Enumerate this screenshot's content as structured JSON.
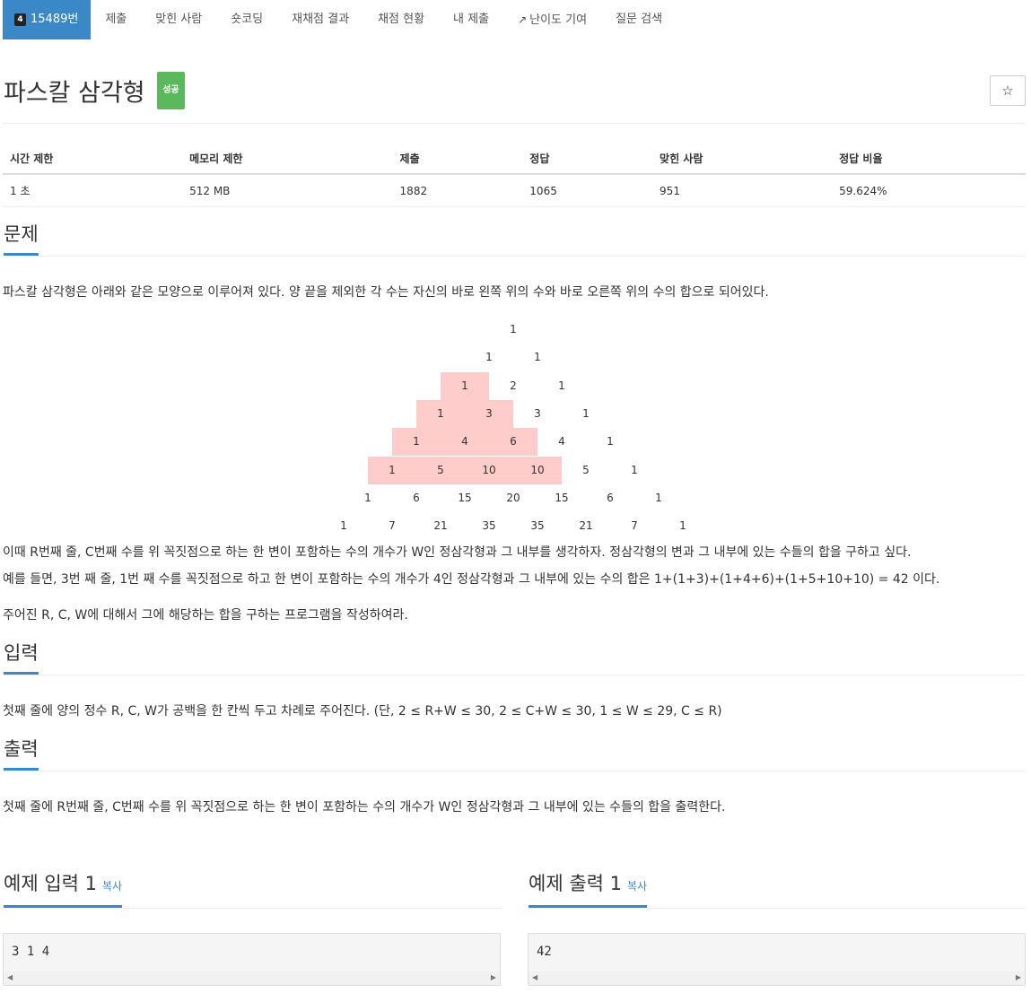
{
  "tabs": {
    "problem": {
      "tier": "4",
      "label": "15489번"
    },
    "items": [
      "제출",
      "맞힌 사람",
      "숏코딩",
      "재채점 결과",
      "채점 현황",
      "내 제출",
      "난이도 기여",
      "질문 검색"
    ]
  },
  "title": "파스칼 삼각형",
  "badge": "성공",
  "star": "☆",
  "info": {
    "headers": [
      "시간 제한",
      "메모리 제한",
      "제출",
      "정답",
      "맞힌 사람",
      "정답 비율"
    ],
    "values": [
      "1 초",
      "512 MB",
      "1882",
      "1065",
      "951",
      "59.624%"
    ]
  },
  "problem": {
    "heading": "문제",
    "intro": "파스칼 삼각형은 아래와 같은 모양으로 이루어져 있다. 양 끝을 제외한 각 수는 자신의 바로 왼쪽 위의 수와 바로 오른쪽 위의 수의 합으로 되어있다.",
    "triangle": [
      [
        "1"
      ],
      [
        "1",
        "1"
      ],
      [
        "1",
        "2",
        "1"
      ],
      [
        "1",
        "3",
        "3",
        "1"
      ],
      [
        "1",
        "4",
        "6",
        "4",
        "1"
      ],
      [
        "1",
        "5",
        "10",
        "10",
        "5",
        "1"
      ],
      [
        "1",
        "6",
        "15",
        "20",
        "15",
        "6",
        "1"
      ],
      [
        "1",
        "7",
        "21",
        "35",
        "35",
        "21",
        "7",
        "1"
      ]
    ],
    "highlighted": [
      [
        2,
        0
      ],
      [
        3,
        0
      ],
      [
        3,
        1
      ],
      [
        4,
        0
      ],
      [
        4,
        1
      ],
      [
        4,
        2
      ],
      [
        5,
        0
      ],
      [
        5,
        1
      ],
      [
        5,
        2
      ],
      [
        5,
        3
      ]
    ],
    "highlight_color": "#ffcccc",
    "para1": "이때 R번째 줄, C번째 수를 위 꼭짓점으로 하는 한 변이 포함하는 수의 개수가 W인 정삼각형과 그 내부를 생각하자. 정삼각형의 변과 그 내부에 있는 수들의 합을 구하고 싶다.",
    "para2": "예를 들면, 3번 째 줄, 1번 째 수를 꼭짓점으로 하고 한 변이 포함하는 수의 개수가 4인 정삼각형과 그 내부에 있는 수의 합은 1+(1+3)+(1+4+6)+(1+5+10+10) = 42 이다.",
    "para3": "주어진 R, C, W에 대해서 그에 해당하는 합을 구하는 프로그램을 작성하여라."
  },
  "input": {
    "heading": "입력",
    "text": "첫째 줄에 양의 정수 R, C, W가 공백을 한 칸씩 두고 차례로 주어진다. (단, 2 ≤ R+W ≤ 30, 2 ≤ C+W ≤ 30, 1 ≤ W ≤ 29, C ≤ R)"
  },
  "output": {
    "heading": "출력",
    "text": "첫째 줄에 R번째 줄, C번째 수를 위 꼭짓점으로 하는 한 변이 포함하는 수의 개수가 W인 정삼각형과 그 내부에 있는 수들의 합을 출력한다."
  },
  "samples": {
    "input_heading": "예제 입력 1",
    "output_heading": "예제 출력 1",
    "copy": "복사",
    "input_value": "3 1 4",
    "output_value": "42"
  },
  "colors": {
    "accent": "#3b88c8",
    "success": "#5cb85c"
  }
}
